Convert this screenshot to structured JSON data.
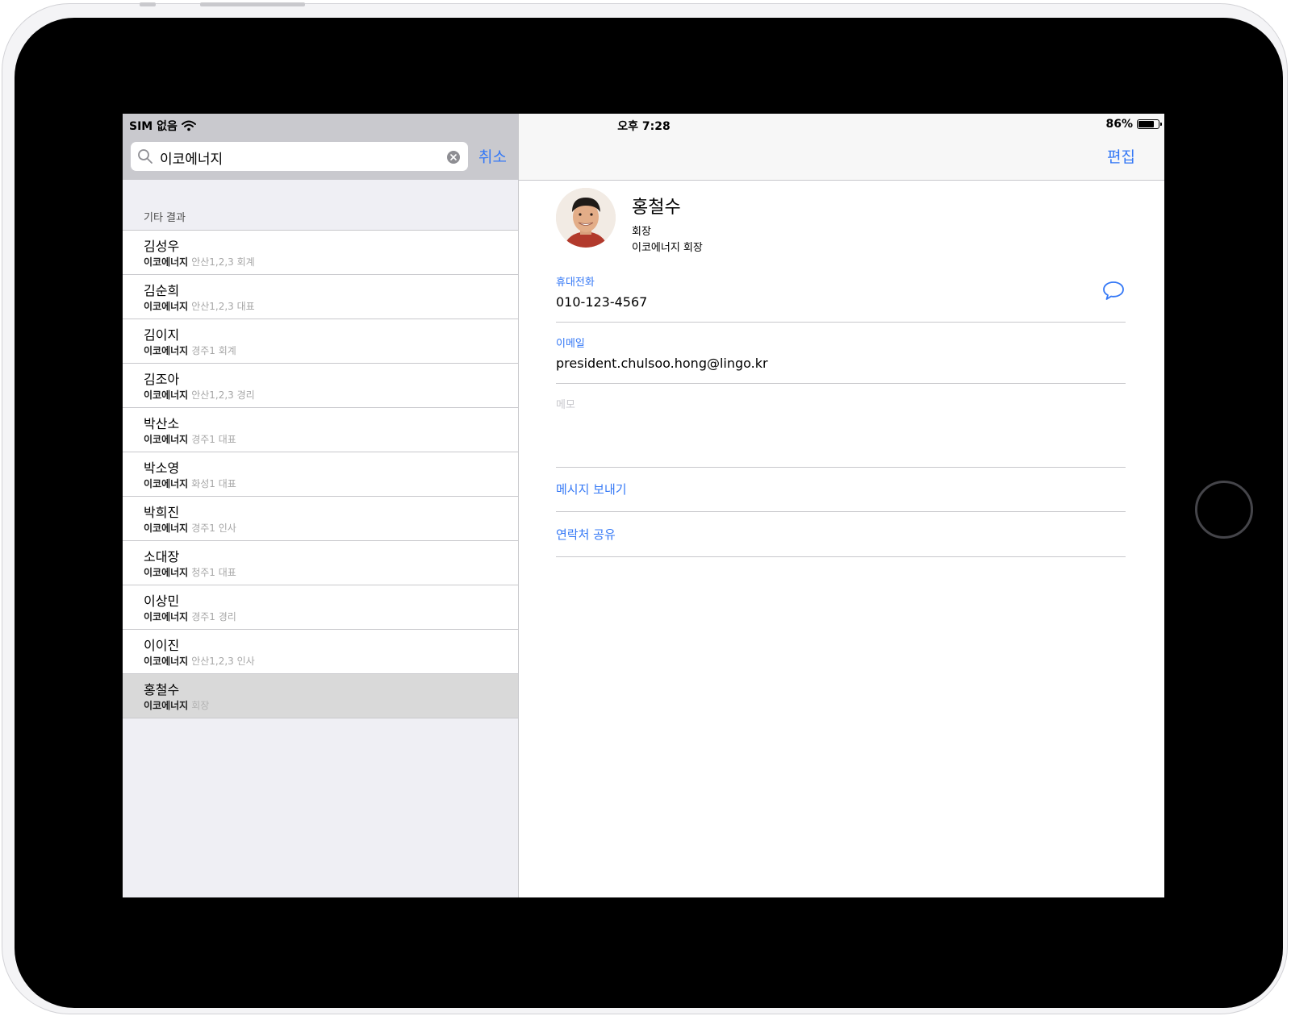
{
  "status_bar": {
    "carrier": "SIM 없음",
    "time": "오후 7:28",
    "battery_percent_text": "86%",
    "battery_level": 0.86
  },
  "search": {
    "query": "이코에너지",
    "cancel_label": "취소"
  },
  "results": {
    "section_header": "기타 결과",
    "items": [
      {
        "name": "김성우",
        "company": "이코에너지",
        "detail": "안산1,2,3 회계"
      },
      {
        "name": "김순희",
        "company": "이코에너지",
        "detail": "안산1,2,3 대표"
      },
      {
        "name": "김이지",
        "company": "이코에너지",
        "detail": "경주1 회계"
      },
      {
        "name": "김조아",
        "company": "이코에너지",
        "detail": "안산1,2,3 경리"
      },
      {
        "name": "박산소",
        "company": "이코에너지",
        "detail": "경주1 대표"
      },
      {
        "name": "박소영",
        "company": "이코에너지",
        "detail": "화성1 대표"
      },
      {
        "name": "박희진",
        "company": "이코에너지",
        "detail": "경주1 인사"
      },
      {
        "name": "소대장",
        "company": "이코에너지",
        "detail": "청주1 대표"
      },
      {
        "name": "이상민",
        "company": "이코에너지",
        "detail": "경주1 경리"
      },
      {
        "name": "이이진",
        "company": "이코에너지",
        "detail": "안산1,2,3 인사"
      },
      {
        "name": "홍철수",
        "company": "이코에너지",
        "detail": "회장"
      }
    ],
    "selected_index": 10
  },
  "detail": {
    "edit_label": "편집",
    "name": "홍철수",
    "title": "회장",
    "organization": "이코에너지 회장",
    "phone": {
      "label": "휴대전화",
      "value": "010-123-4567"
    },
    "email": {
      "label": "이메일",
      "value": "president.chulsoo.hong@lingo.kr"
    },
    "memo": {
      "label": "메모",
      "value": ""
    },
    "actions": {
      "send_message": "메시지 보내기",
      "share_contact": "연락처 공유"
    }
  },
  "colors": {
    "accent": "#3478f6",
    "bezel": "#000000",
    "search_bar_bg": "#c9c9ce",
    "selected_row": "#d9d9d9"
  }
}
